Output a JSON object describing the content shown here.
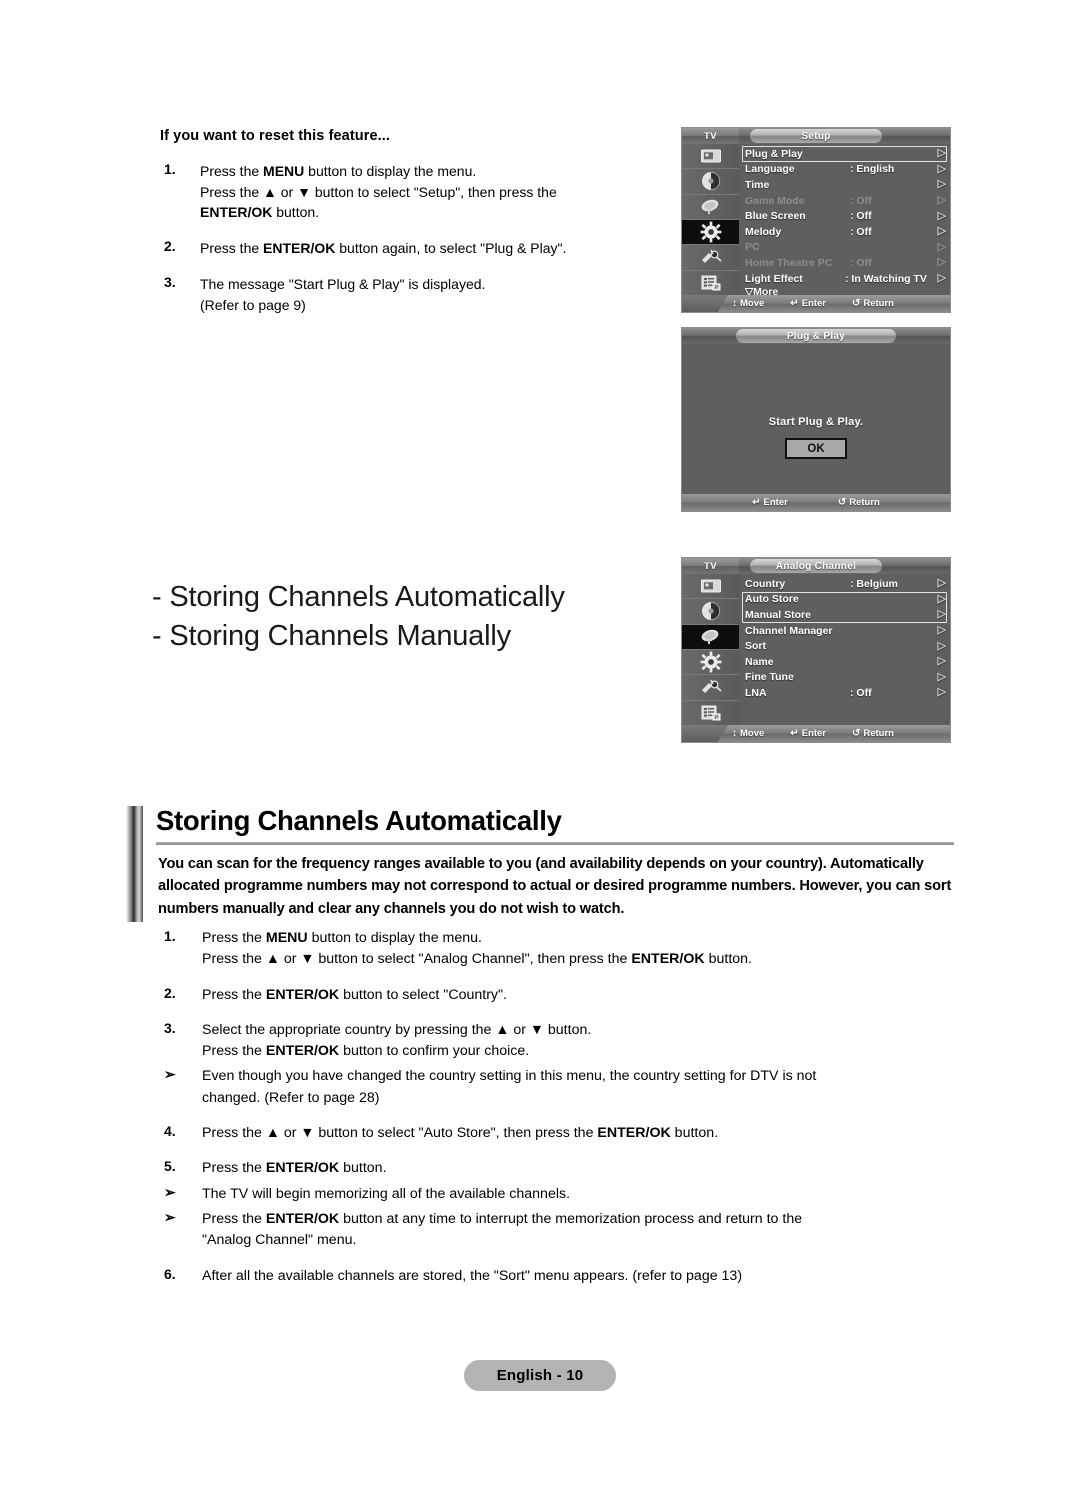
{
  "reset_section": {
    "heading": "If you want to reset this feature...",
    "steps": [
      {
        "num": "1.",
        "lines": [
          [
            {
              "t": "Press the "
            },
            {
              "t": "MENU",
              "b": true
            },
            {
              "t": " button to display the menu."
            }
          ],
          [
            {
              "t": "Press the ▲ or ▼ button to select \"Setup\", then press the"
            }
          ],
          [
            {
              "t": "ENTER/OK",
              "b": true
            },
            {
              "t": " button."
            }
          ]
        ]
      },
      {
        "num": "2.",
        "lines": [
          [
            {
              "t": "Press the "
            },
            {
              "t": "ENTER/OK",
              "b": true
            },
            {
              "t": " button again, to select \"Plug & Play\"."
            }
          ]
        ]
      },
      {
        "num": "3.",
        "lines": [
          [
            {
              "t": "The message \"Start Plug & Play\" is displayed."
            }
          ],
          [
            {
              "t": "(Refer to page 9)"
            }
          ]
        ]
      }
    ]
  },
  "subheadings": [
    "- Storing Channels Automatically",
    "- Storing Channels Manually"
  ],
  "osd_setup": {
    "tv_tag": "TV",
    "title": "Setup",
    "sidebar_icons": [
      "picture-icon",
      "sound-icon",
      "channel-dish-icon",
      "setup-gear-icon",
      "input-plug-icon",
      "pip-list-icon"
    ],
    "active_icon_index": 3,
    "rows": [
      {
        "label": "Plug & Play",
        "value": "",
        "dim": false,
        "selected": true
      },
      {
        "label": "Language",
        "value": ": English",
        "dim": false,
        "selected": false
      },
      {
        "label": "Time",
        "value": "",
        "dim": false,
        "selected": false
      },
      {
        "label": "Game Mode",
        "value": ": Off",
        "dim": true,
        "selected": false
      },
      {
        "label": "Blue Screen",
        "value": ": Off",
        "dim": false,
        "selected": false
      },
      {
        "label": "Melody",
        "value": ": Off",
        "dim": false,
        "selected": false
      },
      {
        "label": "PC",
        "value": "",
        "dim": true,
        "selected": false
      },
      {
        "label": "Home Theatre PC",
        "value": ": Off",
        "dim": true,
        "selected": false
      },
      {
        "label": "Light Effect",
        "value": ": In Watching TV",
        "dim": false,
        "selected": false
      }
    ],
    "more_label": "▽More",
    "footer": [
      {
        "glyph": "↕",
        "label": "Move"
      },
      {
        "glyph": "↵",
        "label": "Enter"
      },
      {
        "glyph": "↺",
        "label": "Return"
      }
    ]
  },
  "osd_plug_play": {
    "title": "Plug & Play",
    "message": "Start Plug & Play.",
    "ok_label": "OK",
    "footer": [
      {
        "glyph": "↵",
        "label": "Enter"
      },
      {
        "glyph": "↺",
        "label": "Return"
      }
    ]
  },
  "osd_analog": {
    "tv_tag": "TV",
    "title": "Analog Channel",
    "sidebar_icons": [
      "picture-icon",
      "sound-icon",
      "channel-dish-icon",
      "setup-gear-icon",
      "input-plug-icon",
      "pip-list-icon"
    ],
    "active_icon_index": 2,
    "rows": [
      {
        "label": "Country",
        "value": ": Belgium",
        "dim": false,
        "selected": false
      },
      {
        "label": "Auto Store",
        "value": "",
        "dim": false,
        "selected": true
      },
      {
        "label": "Manual Store",
        "value": "",
        "dim": false,
        "selected": true
      },
      {
        "label": "Channel Manager",
        "value": "",
        "dim": false,
        "selected": false
      },
      {
        "label": "Sort",
        "value": "",
        "dim": false,
        "selected": false
      },
      {
        "label": "Name",
        "value": "",
        "dim": false,
        "selected": false
      },
      {
        "label": "Fine Tune",
        "value": "",
        "dim": false,
        "selected": false
      },
      {
        "label": "LNA",
        "value": ": Off",
        "dim": false,
        "selected": false
      }
    ],
    "footer": [
      {
        "glyph": "↕",
        "label": "Move"
      },
      {
        "glyph": "↵",
        "label": "Enter"
      },
      {
        "glyph": "↺",
        "label": "Return"
      }
    ]
  },
  "main_section": {
    "title": "Storing Channels Automatically",
    "lead": "You can scan for the frequency ranges available to you (and availability depends on your country). Automatically allocated programme numbers may not correspond to actual or desired programme numbers. However, you can sort numbers manually and clear any channels you do not wish to watch.",
    "steps": [
      {
        "num": "1.",
        "tight": false,
        "lines": [
          [
            {
              "t": "Press the "
            },
            {
              "t": "MENU",
              "b": true
            },
            {
              "t": " button to display the menu."
            }
          ],
          [
            {
              "t": "Press the ▲ or ▼ button to select \"Analog Channel\", then press the "
            },
            {
              "t": "ENTER/OK",
              "b": true
            },
            {
              "t": " button."
            }
          ]
        ]
      },
      {
        "num": "2.",
        "tight": false,
        "lines": [
          [
            {
              "t": "Press the "
            },
            {
              "t": "ENTER/OK",
              "b": true
            },
            {
              "t": " button to select \"Country\"."
            }
          ]
        ]
      },
      {
        "num": "3.",
        "tight": true,
        "lines": [
          [
            {
              "t": "Select the appropriate country by pressing the ▲ or ▼ button."
            }
          ],
          [
            {
              "t": "Press the "
            },
            {
              "t": "ENTER/OK",
              "b": true
            },
            {
              "t": " button to confirm your choice."
            }
          ]
        ]
      },
      {
        "num": "➢",
        "tight": false,
        "lines": [
          [
            {
              "t": "Even though you have changed the country setting in this menu, the country setting for DTV is not"
            }
          ],
          [
            {
              "t": "changed. (Refer to page 28)"
            }
          ]
        ]
      },
      {
        "num": "4.",
        "tight": false,
        "lines": [
          [
            {
              "t": "Press the ▲ or ▼ button to select \"Auto Store\", then press the "
            },
            {
              "t": "ENTER/OK",
              "b": true
            },
            {
              "t": " button."
            }
          ]
        ]
      },
      {
        "num": "5.",
        "tight": true,
        "lines": [
          [
            {
              "t": "Press the "
            },
            {
              "t": "ENTER/OK",
              "b": true
            },
            {
              "t": " button."
            }
          ]
        ]
      },
      {
        "num": "➢",
        "tight": true,
        "lines": [
          [
            {
              "t": "The TV will begin memorizing all of the available channels."
            }
          ]
        ]
      },
      {
        "num": "➢",
        "tight": false,
        "lines": [
          [
            {
              "t": "Press the "
            },
            {
              "t": "ENTER/OK",
              "b": true
            },
            {
              "t": " button at any time to interrupt the memorization process and return to the"
            }
          ],
          [
            {
              "t": "\"Analog Channel\" menu."
            }
          ]
        ]
      },
      {
        "num": "6.",
        "tight": false,
        "lines": [
          [
            {
              "t": "After all the available channels are stored, the \"Sort\" menu appears. (refer to page 13)"
            }
          ]
        ]
      }
    ]
  },
  "footer": {
    "page_label": "English - 10"
  }
}
